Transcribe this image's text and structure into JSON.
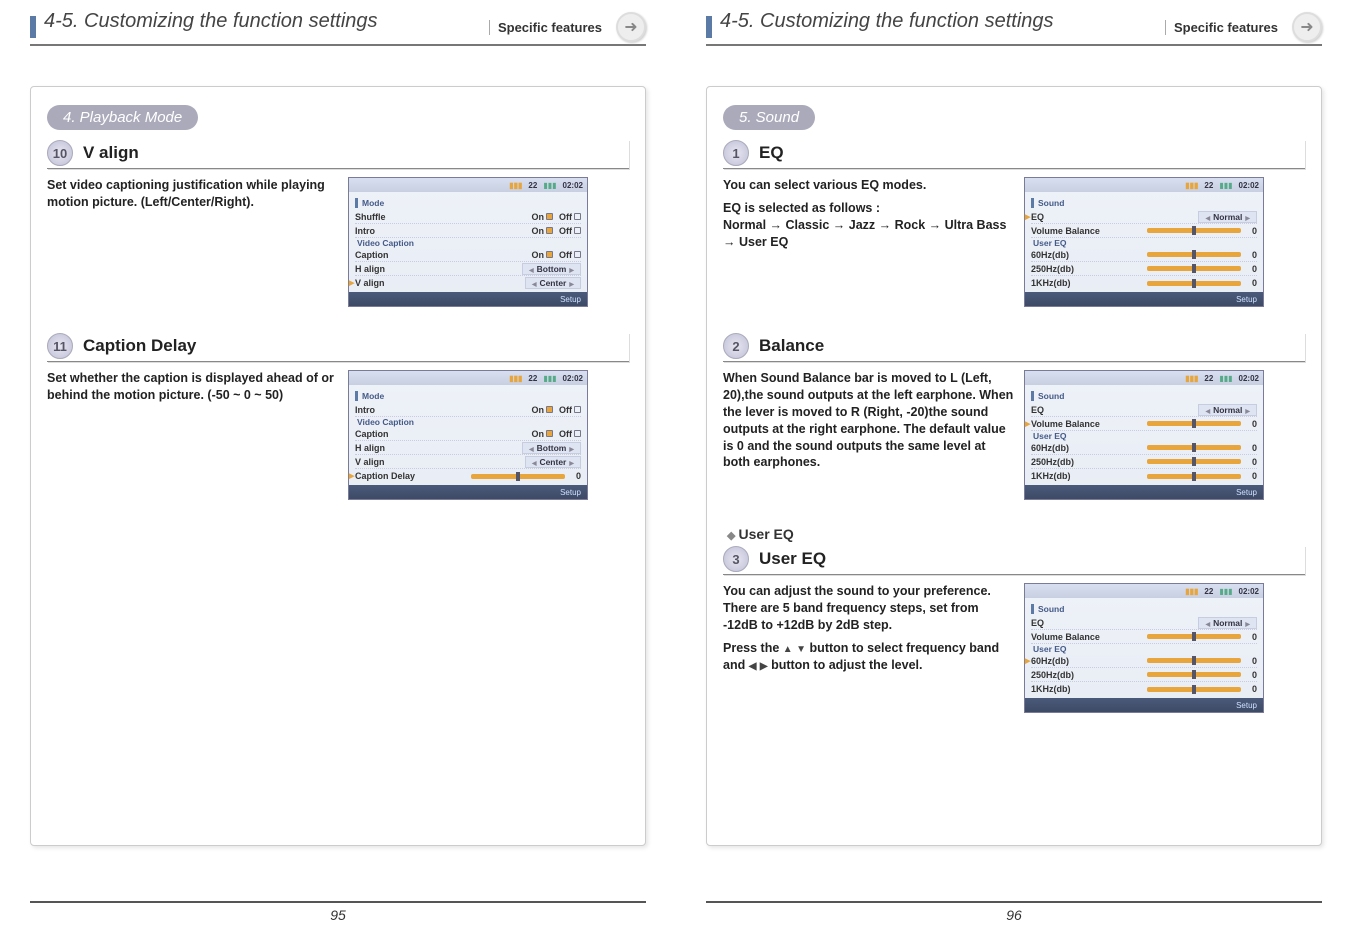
{
  "header": {
    "title": "4-5. Customizing the function settings",
    "sub": "Specific features"
  },
  "left": {
    "pageNum": "95",
    "section": "4. Playback Mode",
    "s10": {
      "num": "10",
      "title": "V align",
      "text": "Set video captioning justification while playing motion picture.\n(Left/Center/Right).",
      "screen": {
        "sig": "22",
        "time": "02:02",
        "cat1": "Mode",
        "r1": {
          "label": "Shuffle",
          "on": "On",
          "off": "Off",
          "sel": "on"
        },
        "r2": {
          "label": "Intro",
          "on": "On",
          "off": "Off",
          "sel": "on"
        },
        "cat2": "Video Caption",
        "r3": {
          "label": "Caption",
          "on": "On",
          "off": "Off",
          "sel": "on"
        },
        "r4": {
          "label": "H align",
          "val": "Bottom"
        },
        "r5": {
          "label": "V align",
          "val": "Center"
        },
        "footer": "Setup"
      }
    },
    "s11": {
      "num": "11",
      "title": "Caption Delay",
      "text": "Set whether the caption is displayed ahead of or behind the motion picture.\n(-50 ~ 0 ~ 50)",
      "screen": {
        "sig": "22",
        "time": "02:02",
        "cat1": "Mode",
        "r1": {
          "label": "Intro",
          "on": "On",
          "off": "Off",
          "sel": "on"
        },
        "cat2": "Video Caption",
        "r2": {
          "label": "Caption",
          "on": "On",
          "off": "Off",
          "sel": "on"
        },
        "r3": {
          "label": "H align",
          "val": "Bottom"
        },
        "r4": {
          "label": "V align",
          "val": "Center"
        },
        "r5": {
          "label": "Caption Delay",
          "num": "0"
        },
        "footer": "Setup"
      }
    }
  },
  "right": {
    "pageNum": "96",
    "section": "5. Sound",
    "s1": {
      "num": "1",
      "title": "EQ",
      "text1": "You can select various EQ modes.",
      "text2": "EQ is selected as follows :\nNormal  → Classic  → Jazz  → Rock  → Ultra Bass  → User EQ",
      "screen": {
        "sig": "22",
        "time": "02:02",
        "cat1": "Sound",
        "r1": {
          "label": "EQ",
          "val": "Normal"
        },
        "r2": {
          "label": "Volume Balance",
          "num": "0"
        },
        "cat2": "User EQ",
        "r3": {
          "label": "60Hz(db)",
          "num": "0"
        },
        "r4": {
          "label": "250Hz(db)",
          "num": "0"
        },
        "r5": {
          "label": "1KHz(db)",
          "num": "0"
        },
        "footer": "Setup"
      }
    },
    "s2": {
      "num": "2",
      "title": "Balance",
      "text": "When Sound Balance bar is moved to L (Left, 20),the sound outputs at the left earphone. When the lever is moved to R (Right, -20)the sound outputs at the right earphone. The default value is 0 and the sound outputs the same level at both earphones.",
      "screen": {
        "sig": "22",
        "time": "02:02",
        "cat1": "Sound",
        "r1": {
          "label": "EQ",
          "val": "Normal"
        },
        "r2": {
          "label": "Volume Balance",
          "num": "0"
        },
        "cat2": "User EQ",
        "r3": {
          "label": "60Hz(db)",
          "num": "0"
        },
        "r4": {
          "label": "250Hz(db)",
          "num": "0"
        },
        "r5": {
          "label": "1KHz(db)",
          "num": "0"
        },
        "footer": "Setup"
      }
    },
    "userEqHead": "User EQ",
    "s3": {
      "num": "3",
      "title": "User EQ",
      "text1": "You can adjust the sound to your preference. There are 5 band frequency steps, set from -12dB to +12dB by 2dB step.",
      "text2a": "Press the ",
      "text2b": " button to select frequency band and ",
      "text2c": " button to adjust the level.",
      "screen": {
        "sig": "22",
        "time": "02:02",
        "cat1": "Sound",
        "r1": {
          "label": "EQ",
          "val": "Normal"
        },
        "r2": {
          "label": "Volume Balance",
          "num": "0"
        },
        "cat2": "User EQ",
        "r3": {
          "label": "60Hz(db)",
          "num": "0"
        },
        "r4": {
          "label": "250Hz(db)",
          "num": "0"
        },
        "r5": {
          "label": "1KHz(db)",
          "num": "0"
        },
        "footer": "Setup"
      }
    }
  }
}
